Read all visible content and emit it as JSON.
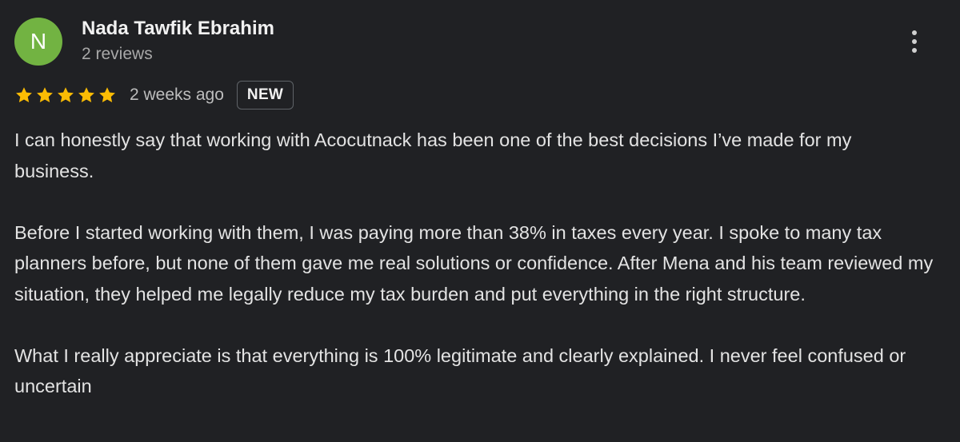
{
  "reviewer": {
    "initial": "N",
    "name": "Nada Tawfik Ebrahim",
    "review_count": "2 reviews",
    "avatar_color": "#72b342"
  },
  "review": {
    "rating": 5,
    "max_rating": 5,
    "star_color": "#fbbc04",
    "time_ago": "2 weeks ago",
    "badge": "NEW",
    "paragraphs": [
      "I can honestly say that working with Acocutnack has been one of the best decisions I’ve made for my business.",
      "Before I started working with them, I was paying more than 38% in taxes every year. I spoke to many tax planners before, but none of them gave me real solutions or confidence. After Mena and his team reviewed my situation, they helped me legally reduce my tax burden and put everything in the right structure.",
      "What I really appreciate is that everything is 100% legitimate and clearly explained. I never feel confused or uncertain"
    ]
  },
  "menu": {
    "icon": "more-vert-icon"
  },
  "colors": {
    "background": "#202124",
    "text_primary": "#e3e3e3",
    "text_secondary": "#a8a8a8",
    "badge_border": "#5f6368"
  }
}
